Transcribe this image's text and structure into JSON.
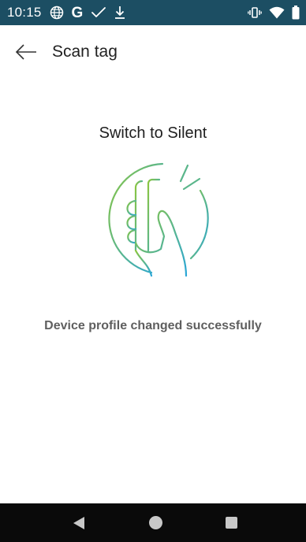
{
  "status_bar": {
    "time": "10:15",
    "left_icons": [
      "globe-icon",
      "google-g-icon",
      "check-icon",
      "download-icon"
    ],
    "google_glyph": "G",
    "right_icons": [
      "vibrate-icon",
      "wifi-icon",
      "battery-icon"
    ],
    "background_color": "#1c4e63"
  },
  "app_bar": {
    "title": "Scan tag"
  },
  "main": {
    "profile_name": "Switch to Silent",
    "illustration": "hand-tap-phone-icon",
    "message": "Device profile changed successfully"
  },
  "nav_bar": {
    "buttons": [
      "back-triangle",
      "home-circle",
      "recents-square"
    ]
  },
  "colors": {
    "gradient_start": "#8cc63f",
    "gradient_end": "#29a6d8",
    "status_bar": "#1c4e63"
  }
}
